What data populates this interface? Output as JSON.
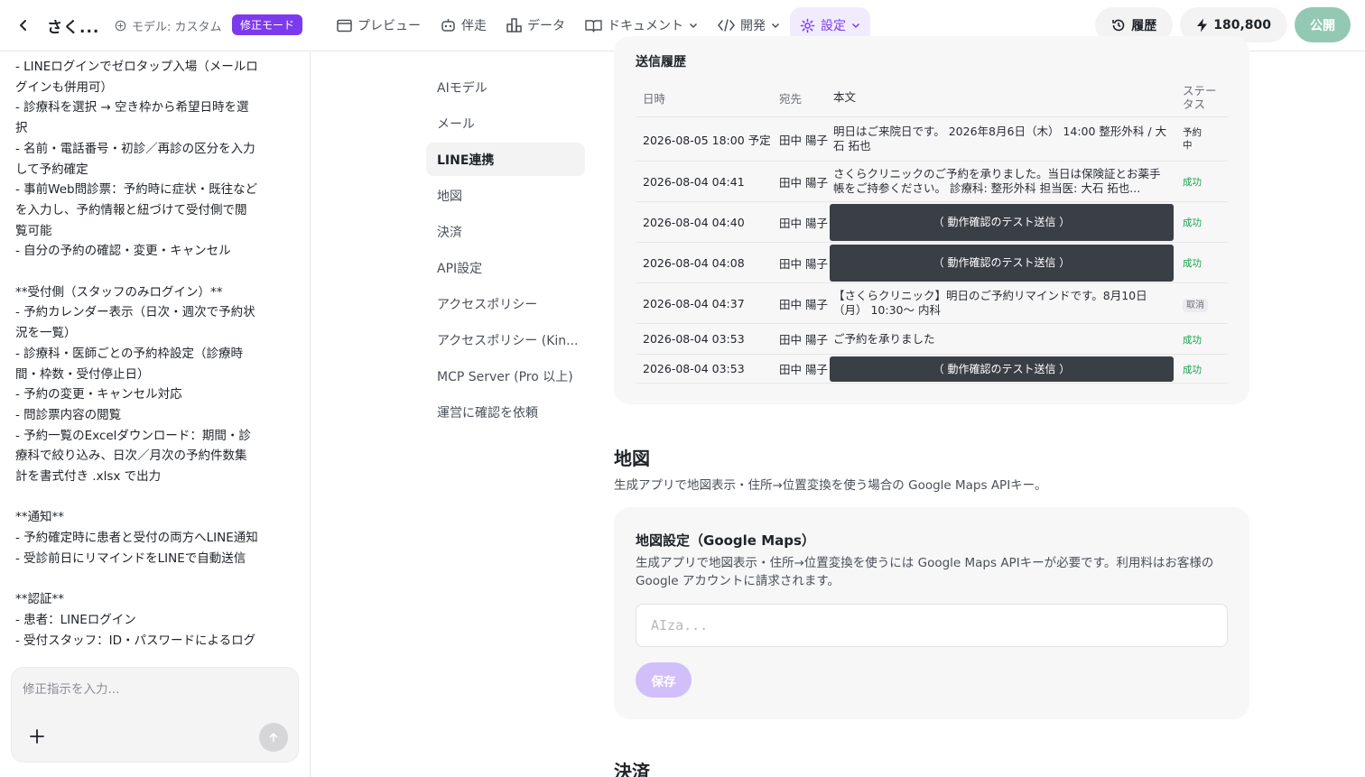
{
  "header": {
    "app_title": "さく...",
    "model_label": "モデル: カスタム",
    "mode_badge": "修正モード",
    "nav": [
      {
        "label": "プレビュー",
        "icon": "window-icon"
      },
      {
        "label": "伴走",
        "icon": "robot-icon"
      },
      {
        "label": "データ",
        "icon": "blocks-icon"
      },
      {
        "label": "ドキュメント",
        "icon": "book-icon"
      },
      {
        "label": "開発",
        "icon": "code-icon"
      },
      {
        "label": "設定",
        "icon": "gear-icon"
      }
    ],
    "history_label": "履歴",
    "credits": "180,800",
    "publish_label": "公開"
  },
  "chat": {
    "lines": [
      "- LINEログインでゼロタップ入場（メールロ",
      "グインも併用可）",
      "- 診療科を選択 → 空き枠から希望日時を選",
      "択",
      "- 名前・電話番号・初診／再診の区分を入力",
      "して予約確定",
      "- 事前Web問診票：予約時に症状・既往など",
      "を入力し、予約情報と紐づけて受付側で閲",
      "覧可能",
      "- 自分の予約の確認・変更・キャンセル",
      "",
      "**受付側（スタッフのみログイン）**",
      "- 予約カレンダー表示（日次・週次で予約状",
      "況を一覧）",
      "- 診療科・医師ごとの予約枠設定（診療時",
      "間・枠数・受付停止日）",
      "- 予約の変更・キャンセル対応",
      "- 問診票内容の閲覧",
      "- 予約一覧のExcelダウンロード：期間・診",
      "療科で絞り込み、日次／月次の予約件数集",
      "計を書式付き .xlsx で出力",
      "",
      "**通知**",
      "- 予約確定時に患者と受付の両方へLINE通知",
      "- 受診前日にリマインドをLINEで自動送信",
      "",
      "**認証**",
      "- 患者：LINEログイン",
      "- 受付スタッフ：ID・パスワードによるログ"
    ],
    "input_placeholder": "修正指示を入力..."
  },
  "settings_nav": {
    "items": [
      "AIモデル",
      "メール",
      "LINE連携",
      "地図",
      "決済",
      "API設定",
      "アクセスポリシー",
      "アクセスポリシー (Kin...",
      "MCP Server (Pro 以上)",
      "運営に確認を依頼"
    ],
    "active_index": 2
  },
  "history": {
    "title": "送信履歴",
    "columns": [
      "日時",
      "宛先",
      "本文",
      "ステータス"
    ],
    "rows": [
      {
        "date": "2026-08-05 18:00 予定",
        "to": "田中 陽子",
        "body": "明日はご来院日です。 2026年8月6日（木） 14:00 整形外科 / 大石 拓也",
        "status": "予約中",
        "kind": "scheduled"
      },
      {
        "date": "2026-08-04 04:41",
        "to": "田中 陽子",
        "body": "さくらクリニックのご予約を承りました。当日は保険証とお薬手帳をご持参ください。 診療科: 整形外科 担当医: 大石 拓也...",
        "status": "成功",
        "kind": "success"
      },
      {
        "date": "2026-08-04 04:40",
        "to": "田中 陽子",
        "body": "（ 動作確認のテスト送信 ）",
        "status": "成功",
        "kind": "success-dark"
      },
      {
        "date": "2026-08-04 04:08",
        "to": "田中 陽子",
        "body": "（ 動作確認のテスト送信 ）",
        "status": "成功",
        "kind": "success-dark"
      },
      {
        "date": "2026-08-04 04:37",
        "to": "田中 陽子",
        "body": "【さくらクリニック】明日のご予約リマインドです。8月10日（月） 10:30〜 内科",
        "status": "取消",
        "kind": "cancel"
      },
      {
        "date": "2026-08-04 03:53",
        "to": "田中 陽子",
        "body": "ご予約を承りました",
        "status": "成功",
        "kind": "success"
      },
      {
        "date": "2026-08-04 03:53",
        "to": "田中 陽子",
        "body": "（ 動作確認のテスト送信 ）",
        "status": "成功",
        "kind": "success-dark"
      }
    ]
  },
  "map_section": {
    "title": "地図",
    "description": "生成アプリで地図表示・住所→位置変換を使う場合の Google Maps APIキー。",
    "card_title": "地図設定（Google Maps）",
    "card_description": "生成アプリで地図表示・住所→位置変換を使うには Google Maps APIキーが必要です。利用料はお客様の Google アカウントに請求されます。",
    "input_placeholder": "AIza...",
    "save_label": "保存"
  },
  "payment_section": {
    "title": "決済"
  },
  "colors": {
    "accent": "#7c3aed",
    "success": "#16a34a",
    "publish": "#93c9b4"
  }
}
